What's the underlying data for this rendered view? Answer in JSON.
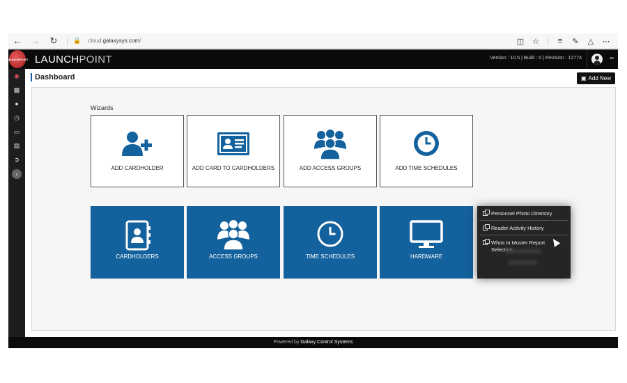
{
  "browser": {
    "url_prefix": "cloud.",
    "url_domain": "galaxysys.com",
    "url_suffix": "/"
  },
  "header": {
    "logo_text": "LAUNCHPOINT",
    "brand_a": "LAUNCH",
    "brand_b": "POINT",
    "version": "Version : 10.5  |  Build : 0  |  Revision : 12774",
    "user_menu": "••"
  },
  "page": {
    "title": "Dashboard",
    "add_new_label": "Add New"
  },
  "wizards": {
    "label": "Wizards",
    "items": [
      {
        "label": "ADD CARDHOLDER",
        "icon": "add-user-icon"
      },
      {
        "label": "ADD CARD TO CARDHOLDERS",
        "icon": "id-card-icon"
      },
      {
        "label": "ADD ACCESS GROUPS",
        "icon": "group-icon"
      },
      {
        "label": "ADD TIME SCHEDULES",
        "icon": "clock-icon"
      }
    ]
  },
  "tiles": [
    {
      "label": "CARDHOLDERS",
      "icon": "address-book-icon"
    },
    {
      "label": "ACCESS GROUPS",
      "icon": "group-icon"
    },
    {
      "label": "TIME SCHEDULES",
      "icon": "clock-icon"
    },
    {
      "label": "HARDWARE",
      "icon": "monitor-icon"
    }
  ],
  "reports_menu": {
    "items": [
      {
        "label": "Personnel Photo Directory"
      },
      {
        "label": "Reader Activity History"
      },
      {
        "label": "Whos In Muster Report Selection"
      }
    ]
  },
  "footer": {
    "prefix": "Powered by ",
    "company": "Galaxy Control Systems"
  },
  "colors": {
    "tile_blue": "#13619d",
    "accent_red": "#d94f5c",
    "header_black": "#0b0b0b"
  }
}
